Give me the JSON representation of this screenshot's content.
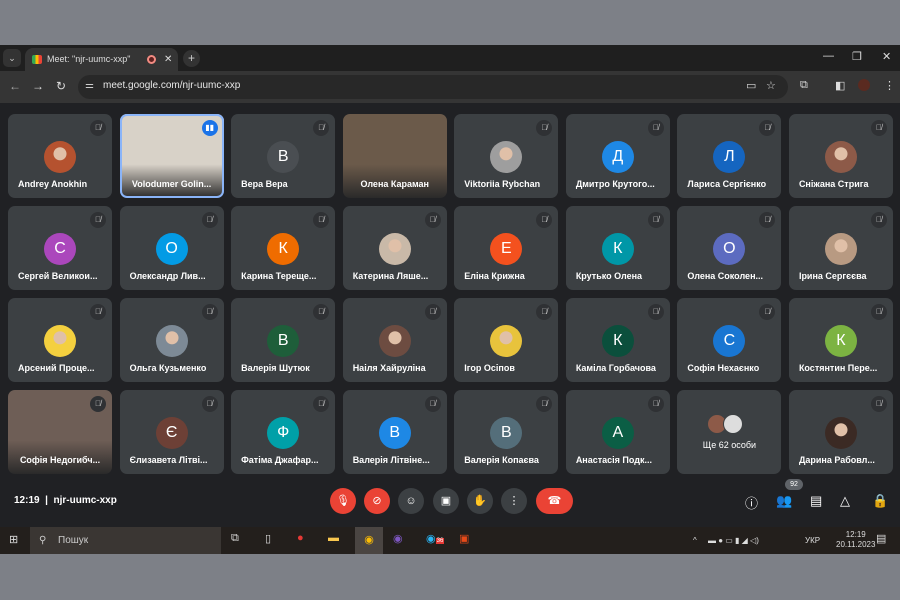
{
  "browser": {
    "tab_title": "Meet: \"njr-uumc-xxp\"",
    "url": "meet.google.com/njr-uumc-xxp"
  },
  "participants": [
    {
      "name": "Andrey Anokhin",
      "type": "photo",
      "color": "#b5522f"
    },
    {
      "name": "Volodumer Golin...",
      "type": "video",
      "color": "#d8d2c8",
      "speaking": true
    },
    {
      "name": "Вера Вера",
      "type": "initial",
      "initial": "В",
      "color": "#4a4e52"
    },
    {
      "name": "Олена Караман",
      "type": "video",
      "color": "#6b5a4a"
    },
    {
      "name": "Viktoriia Rybchan",
      "type": "photo",
      "color": "#9e9e9e"
    },
    {
      "name": "Дмитро Крутого...",
      "type": "initial",
      "initial": "Д",
      "color": "#1e88e5"
    },
    {
      "name": "Лариса Сергієнко",
      "type": "initial",
      "initial": "Л",
      "color": "#1565c0"
    },
    {
      "name": "Сніжана Стрига",
      "type": "photo",
      "color": "#8d5a48"
    },
    {
      "name": "Сергей Великои...",
      "type": "initial",
      "initial": "С",
      "color": "#ab47bc"
    },
    {
      "name": "Олександр Лив...",
      "type": "initial",
      "initial": "О",
      "color": "#039be5"
    },
    {
      "name": "Карина Терещe...",
      "type": "initial",
      "initial": "К",
      "color": "#ef6c00"
    },
    {
      "name": "Катерина Ляше...",
      "type": "photo",
      "color": "#c9b9a8"
    },
    {
      "name": "Еліна Крижна",
      "type": "initial",
      "initial": "Е",
      "color": "#f4511e"
    },
    {
      "name": "Крутько Олена",
      "type": "initial",
      "initial": "К",
      "color": "#0097a7"
    },
    {
      "name": "Олена Соколен...",
      "type": "initial",
      "initial": "О",
      "color": "#5c6bc0"
    },
    {
      "name": "Ірина Сергєєва",
      "type": "photo",
      "color": "#b89a82"
    },
    {
      "name": "Арсений Проце...",
      "type": "photo",
      "color": "#f4d03f"
    },
    {
      "name": "Ольга Кузьменко",
      "type": "photo",
      "color": "#7d8a96"
    },
    {
      "name": "Валерія Шутюк",
      "type": "initial",
      "initial": "В",
      "color": "#1e5e3a"
    },
    {
      "name": "Наіля Хайруліна",
      "type": "photo",
      "color": "#6d4c41"
    },
    {
      "name": "Ігор Осіпов",
      "type": "photo",
      "color": "#e8c33c"
    },
    {
      "name": "Каміла Горбачова",
      "type": "initial",
      "initial": "К",
      "color": "#0b4f3c"
    },
    {
      "name": "Софія Нехаєнко",
      "type": "initial",
      "initial": "С",
      "color": "#1976d2"
    },
    {
      "name": "Костянтин Пере...",
      "type": "initial",
      "initial": "К",
      "color": "#7cb342"
    },
    {
      "name": "Софія Недогибч...",
      "type": "video",
      "color": "#6e5e56"
    },
    {
      "name": "Єлизавета Літві...",
      "type": "initial",
      "initial": "Є",
      "color": "#6d4036"
    },
    {
      "name": "Фатіма Джафар...",
      "type": "initial",
      "initial": "Ф",
      "color": "#00a0a8"
    },
    {
      "name": "Валерія Літвіне...",
      "type": "initial",
      "initial": "В",
      "color": "#1e88e5"
    },
    {
      "name": "Валерія Копаєва",
      "type": "initial",
      "initial": "В",
      "color": "#546e7a"
    },
    {
      "name": "Анастасія Подк...",
      "type": "initial",
      "initial": "А",
      "color": "#0b5e45"
    },
    {
      "name": "Ще 62 особи",
      "type": "more"
    },
    {
      "name": "Дарина Рабовл...",
      "type": "photo",
      "color": "#3b2a24"
    }
  ],
  "meeting": {
    "time": "12:19",
    "code": "njr-uumc-xxp",
    "participant_count": "92"
  },
  "taskbar": {
    "search_placeholder": "Пошук",
    "lang": "УКР",
    "time": "12:19",
    "date": "20.11.2023",
    "telegram_badge": "36"
  }
}
